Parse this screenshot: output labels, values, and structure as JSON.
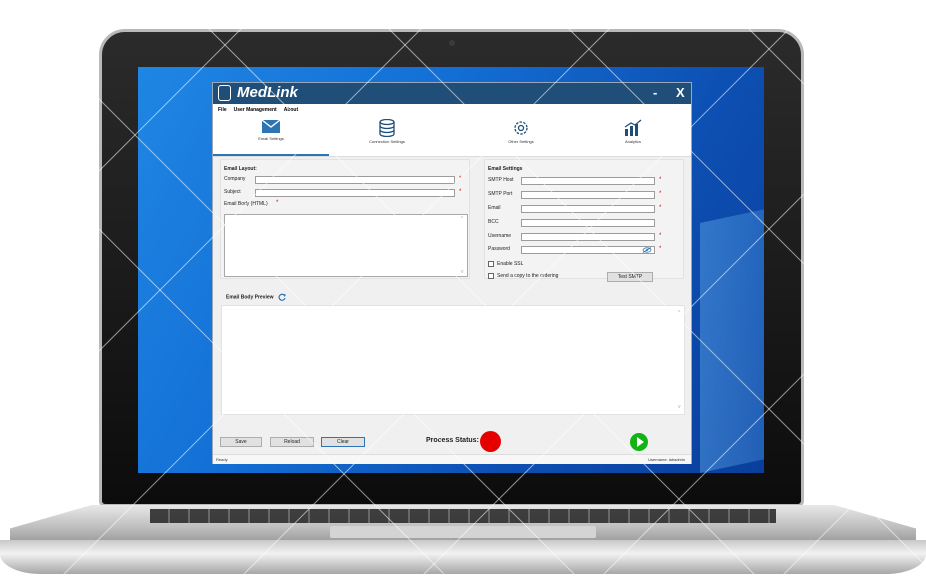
{
  "app": {
    "title": "MedLink",
    "minimize": "-",
    "close": "X"
  },
  "menu": [
    "File",
    "User Management",
    "About"
  ],
  "tabs": [
    {
      "label": "Email Settings",
      "icon": "envelope-icon",
      "active": true
    },
    {
      "label": "Connection Settings",
      "icon": "database-icon",
      "active": false
    },
    {
      "label": "Other Settings",
      "icon": "gear-icon",
      "active": false
    },
    {
      "label": "Analytics",
      "icon": "bar-chart-icon",
      "active": false
    }
  ],
  "email_layout": {
    "title": "Email Layout:",
    "company_label": "Company",
    "company_value": "",
    "subject_label": "Subject",
    "subject_value": "",
    "body_label": "Email Body (HTML)",
    "required_mark": "*"
  },
  "email_settings": {
    "title": "Email Settings",
    "smtp_host_label": "SMTP Host",
    "smtp_port_label": "SMTP Port",
    "email_label": "Email",
    "bcc_label": "BCC",
    "username_label": "Username",
    "password_label": "Password",
    "enable_ssl_label": "Enable SSL",
    "send_copy_label": "Send a copy to the ordering",
    "test_smtp_label": "Test SMTP",
    "required_mark": "*"
  },
  "preview": {
    "title": "Email Body Preview"
  },
  "footer": {
    "save": "Save",
    "reload": "Reload",
    "clear": "Clear",
    "process_status_label": "Process Status:",
    "status_color": "#e50000",
    "run_color": "#12b312"
  },
  "statusbar": {
    "ready": "Ready",
    "user": "Username: labadmin"
  },
  "colors": {
    "titlebar": "#1f4e79",
    "accent": "#2c74b3",
    "desktop": "#1470d6"
  }
}
